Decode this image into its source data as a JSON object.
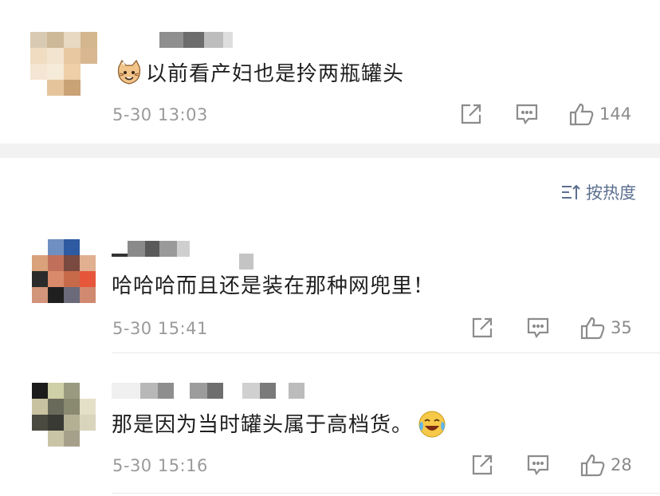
{
  "comments": [
    {
      "text": "以前看产妇也是拎两瓶罐头",
      "time": "5-30 13:03",
      "likes": "144",
      "emoji_prefix": "cat-face-emoji"
    },
    {
      "text": "哈哈哈而且还是装在那种网兜里！",
      "time": "5-30 15:41",
      "likes": "35"
    },
    {
      "text": "那是因为当时罐头属于高档货。",
      "time": "5-30 15:16",
      "likes": "28",
      "emoji_suffix": "crying-laughing-emoji"
    }
  ],
  "sort": {
    "label": "按热度"
  },
  "icons": [
    "share-icon",
    "comment-icon",
    "like-icon",
    "sort-icon"
  ],
  "colors": {
    "meta": "#9a9a9a",
    "sort": "#5b6f8f",
    "band": "#f2f2f2"
  }
}
